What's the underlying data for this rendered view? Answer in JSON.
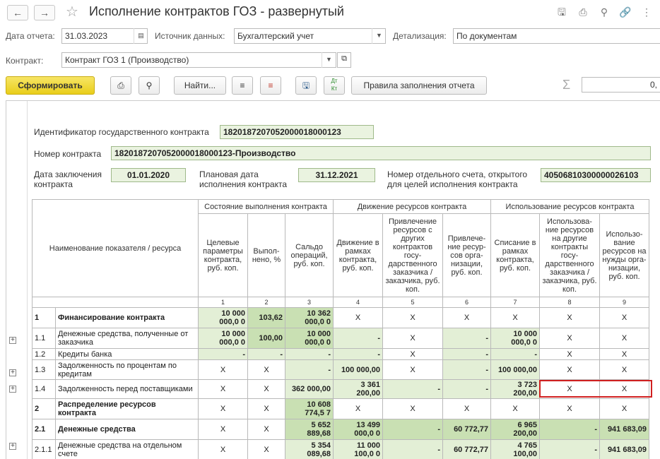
{
  "window": {
    "title": "Исполнение контрактов ГОЗ - развернутый"
  },
  "filters": {
    "report_date_label": "Дата отчета:",
    "report_date_value": "31.03.2023",
    "source_label": "Источник данных:",
    "source_value": "Бухгалтерский учет",
    "detail_label": "Детализация:",
    "detail_value": "По документам",
    "contract_label": "Контракт:",
    "contract_value": "Контракт ГОЗ 1 (Производство)"
  },
  "toolbar": {
    "generate": "Сформировать",
    "find": "Найти...",
    "rules": "Правила заполнения отчета",
    "sum_value": "0,"
  },
  "header": {
    "contract_id_label": "Идентификатор государственного контракта",
    "contract_id_value": "1820187207052000018000123",
    "contract_no_label": "Номер контракта",
    "contract_no_value": "1820187207052000018000123-Производство",
    "conclusion_label_1": "Дата заключения",
    "conclusion_label_2": "контракта",
    "conclusion_value": "01.01.2020",
    "plan_label_1": "Плановая дата",
    "plan_label_2": "исполнения контракта",
    "plan_value": "31.12.2021",
    "account_label_1": "Номер отдельного счета, открытого",
    "account_label_2": "для целей исполнения контракта",
    "account_value": "40506810300000026103"
  },
  "table": {
    "group_state": "Состояние выполнения контракта",
    "group_movement": "Движение ресурсов контракта",
    "group_usage": "Использование ресурсов контракта",
    "col_name": "Наименование показателя / ресурса",
    "cols": [
      "Целевые параметры контракта, руб. коп.",
      "Выпол-нено, %",
      "Сальдо операций, руб. коп.",
      "Движение в рамках контракта, руб. коп.",
      "Привлечение ресурсов с других контрактов госу-дарственного заказчика / заказчика, руб. коп.",
      "Привлече-ние ресур-сов орга-низации, руб. коп.",
      "Списание в рамках контракта, руб. коп.",
      "Использова-ние ресурсов на другие контракты госу-дарственного заказчика / заказчика, руб. коп.",
      "Использо-вание ресурсов на нужды орга-низации, руб. коп."
    ],
    "col_nums": [
      "1",
      "2",
      "3",
      "4",
      "5",
      "6",
      "7",
      "8",
      "9"
    ],
    "rows": [
      {
        "no": "1",
        "name": "Финансирование контракта",
        "bold": true,
        "cells": [
          "10 000 000,0 0",
          "103,62",
          "10 362 000,0 0",
          "X",
          "X",
          "X",
          "X",
          "X",
          "X"
        ]
      },
      {
        "no": "1.1",
        "name": "Денежные средства, полученные от заказчика",
        "bold": false,
        "cells": [
          "10 000 000,0 0",
          "100,00",
          "10 000 000,0 0",
          "-",
          "X",
          "-",
          "10 000 000,0 0",
          "X",
          "X"
        ]
      },
      {
        "no": "1.2",
        "name": "Кредиты банка",
        "bold": false,
        "cells": [
          "-",
          "-",
          "-",
          "-",
          "X",
          "-",
          "-",
          "X",
          "X"
        ]
      },
      {
        "no": "1.3",
        "name": "Задолженность по процентам по кредитам",
        "bold": false,
        "cells": [
          "X",
          "X",
          "-",
          "100 000,00",
          "X",
          "-",
          "100 000,00",
          "X",
          "X"
        ]
      },
      {
        "no": "1.4",
        "name": "Задолженность перед поставщиками",
        "bold": false,
        "cells": [
          "X",
          "X",
          "362 000,00",
          "3 361 200,00",
          "-",
          "-",
          "3 723 200,00",
          "X",
          "X"
        ]
      },
      {
        "no": "2",
        "name": "Распределение ресурсов контракта",
        "bold": true,
        "cells": [
          "X",
          "X",
          "10 608 774,5 7",
          "X",
          "X",
          "X",
          "X",
          "X",
          "X"
        ]
      },
      {
        "no": "2.1",
        "name": "Денежные средства",
        "bold": true,
        "cells": [
          "X",
          "X",
          "5 652 889,68",
          "13 499 000,0 0",
          "-",
          "60 772,77",
          "6 965 200,00",
          "-",
          "941 683,09"
        ]
      },
      {
        "no": "2.1.1",
        "name": "Денежные средства на отдельном счете",
        "bold": false,
        "cells": [
          "X",
          "X",
          "5 354 089,68",
          "11 000 100,0 0",
          "-",
          "60 772,77",
          "4 765 100,00",
          "-",
          "941 683,09"
        ]
      }
    ]
  }
}
